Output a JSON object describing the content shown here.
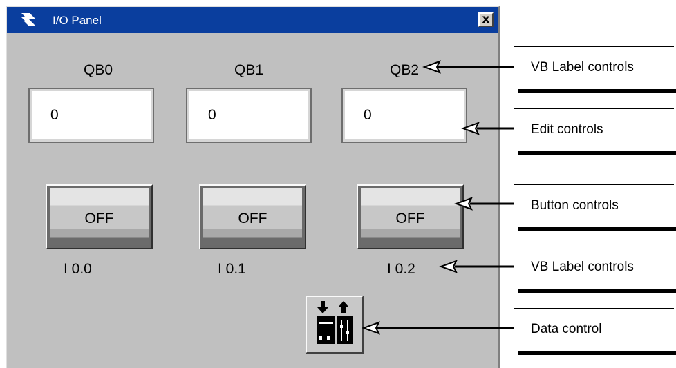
{
  "window": {
    "title": "I/O Panel",
    "close_label": "x"
  },
  "outputs": [
    {
      "label": "QB0",
      "value": "0"
    },
    {
      "label": "QB1",
      "value": "0"
    },
    {
      "label": "QB2",
      "value": "0"
    }
  ],
  "inputs": [
    {
      "button_label": "OFF",
      "label": "I 0.0"
    },
    {
      "button_label": "OFF",
      "label": "I 0.1"
    },
    {
      "button_label": "OFF",
      "label": "I 0.2"
    }
  ],
  "data_control": {
    "icon": "data-transfer-icon"
  },
  "callouts": [
    {
      "text": "VB Label controls"
    },
    {
      "text": "Edit controls"
    },
    {
      "text": "Button controls"
    },
    {
      "text": "VB Label controls"
    },
    {
      "text": "Data control"
    }
  ],
  "colors": {
    "titlebar": "#0a3e9e",
    "window_bg": "#c0c0c0"
  }
}
